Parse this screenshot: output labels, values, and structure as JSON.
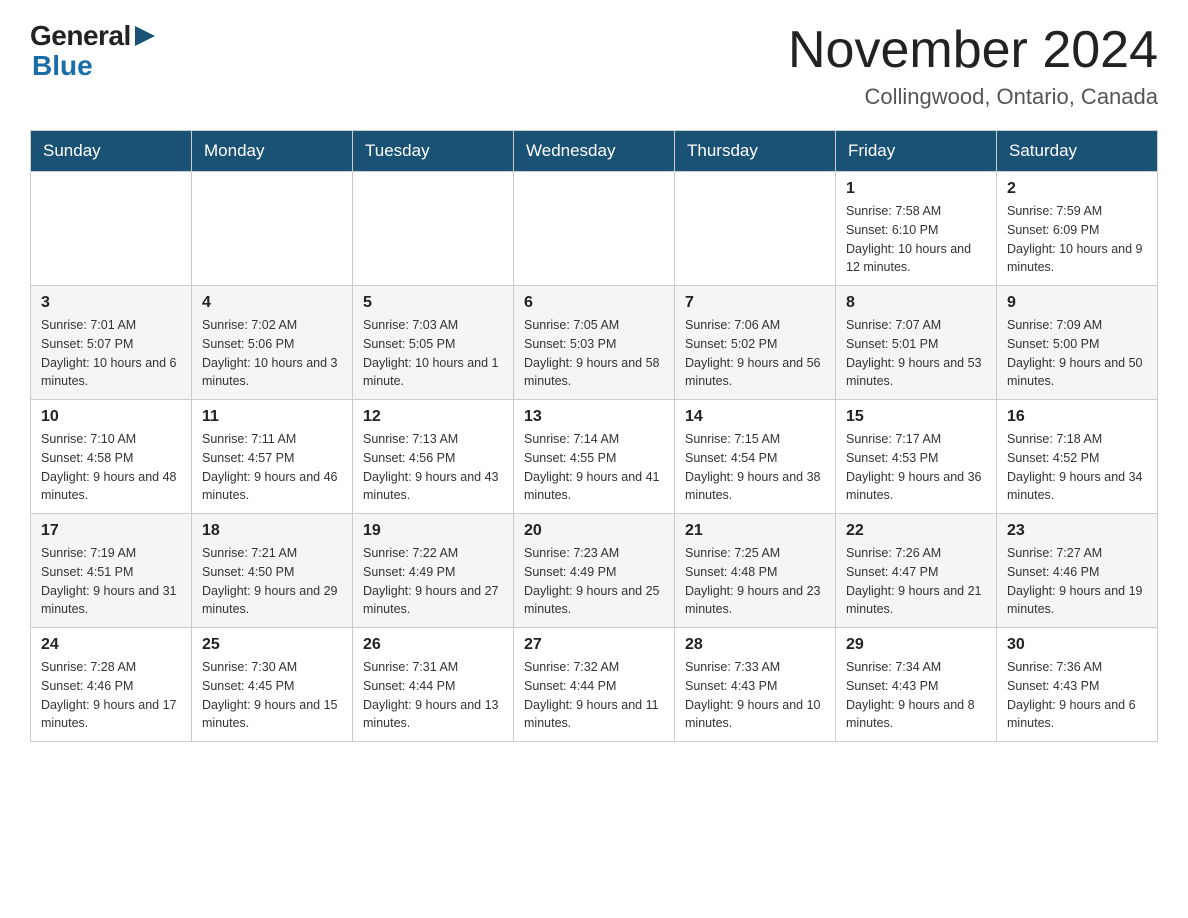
{
  "header": {
    "logo": {
      "general": "General",
      "blue": "Blue"
    },
    "title": "November 2024",
    "subtitle": "Collingwood, Ontario, Canada"
  },
  "weekdays": [
    "Sunday",
    "Monday",
    "Tuesday",
    "Wednesday",
    "Thursday",
    "Friday",
    "Saturday"
  ],
  "weeks": [
    [
      {
        "day": "",
        "sunrise": "",
        "sunset": "",
        "daylight": ""
      },
      {
        "day": "",
        "sunrise": "",
        "sunset": "",
        "daylight": ""
      },
      {
        "day": "",
        "sunrise": "",
        "sunset": "",
        "daylight": ""
      },
      {
        "day": "",
        "sunrise": "",
        "sunset": "",
        "daylight": ""
      },
      {
        "day": "",
        "sunrise": "",
        "sunset": "",
        "daylight": ""
      },
      {
        "day": "1",
        "sunrise": "Sunrise: 7:58 AM",
        "sunset": "Sunset: 6:10 PM",
        "daylight": "Daylight: 10 hours and 12 minutes."
      },
      {
        "day": "2",
        "sunrise": "Sunrise: 7:59 AM",
        "sunset": "Sunset: 6:09 PM",
        "daylight": "Daylight: 10 hours and 9 minutes."
      }
    ],
    [
      {
        "day": "3",
        "sunrise": "Sunrise: 7:01 AM",
        "sunset": "Sunset: 5:07 PM",
        "daylight": "Daylight: 10 hours and 6 minutes."
      },
      {
        "day": "4",
        "sunrise": "Sunrise: 7:02 AM",
        "sunset": "Sunset: 5:06 PM",
        "daylight": "Daylight: 10 hours and 3 minutes."
      },
      {
        "day": "5",
        "sunrise": "Sunrise: 7:03 AM",
        "sunset": "Sunset: 5:05 PM",
        "daylight": "Daylight: 10 hours and 1 minute."
      },
      {
        "day": "6",
        "sunrise": "Sunrise: 7:05 AM",
        "sunset": "Sunset: 5:03 PM",
        "daylight": "Daylight: 9 hours and 58 minutes."
      },
      {
        "day": "7",
        "sunrise": "Sunrise: 7:06 AM",
        "sunset": "Sunset: 5:02 PM",
        "daylight": "Daylight: 9 hours and 56 minutes."
      },
      {
        "day": "8",
        "sunrise": "Sunrise: 7:07 AM",
        "sunset": "Sunset: 5:01 PM",
        "daylight": "Daylight: 9 hours and 53 minutes."
      },
      {
        "day": "9",
        "sunrise": "Sunrise: 7:09 AM",
        "sunset": "Sunset: 5:00 PM",
        "daylight": "Daylight: 9 hours and 50 minutes."
      }
    ],
    [
      {
        "day": "10",
        "sunrise": "Sunrise: 7:10 AM",
        "sunset": "Sunset: 4:58 PM",
        "daylight": "Daylight: 9 hours and 48 minutes."
      },
      {
        "day": "11",
        "sunrise": "Sunrise: 7:11 AM",
        "sunset": "Sunset: 4:57 PM",
        "daylight": "Daylight: 9 hours and 46 minutes."
      },
      {
        "day": "12",
        "sunrise": "Sunrise: 7:13 AM",
        "sunset": "Sunset: 4:56 PM",
        "daylight": "Daylight: 9 hours and 43 minutes."
      },
      {
        "day": "13",
        "sunrise": "Sunrise: 7:14 AM",
        "sunset": "Sunset: 4:55 PM",
        "daylight": "Daylight: 9 hours and 41 minutes."
      },
      {
        "day": "14",
        "sunrise": "Sunrise: 7:15 AM",
        "sunset": "Sunset: 4:54 PM",
        "daylight": "Daylight: 9 hours and 38 minutes."
      },
      {
        "day": "15",
        "sunrise": "Sunrise: 7:17 AM",
        "sunset": "Sunset: 4:53 PM",
        "daylight": "Daylight: 9 hours and 36 minutes."
      },
      {
        "day": "16",
        "sunrise": "Sunrise: 7:18 AM",
        "sunset": "Sunset: 4:52 PM",
        "daylight": "Daylight: 9 hours and 34 minutes."
      }
    ],
    [
      {
        "day": "17",
        "sunrise": "Sunrise: 7:19 AM",
        "sunset": "Sunset: 4:51 PM",
        "daylight": "Daylight: 9 hours and 31 minutes."
      },
      {
        "day": "18",
        "sunrise": "Sunrise: 7:21 AM",
        "sunset": "Sunset: 4:50 PM",
        "daylight": "Daylight: 9 hours and 29 minutes."
      },
      {
        "day": "19",
        "sunrise": "Sunrise: 7:22 AM",
        "sunset": "Sunset: 4:49 PM",
        "daylight": "Daylight: 9 hours and 27 minutes."
      },
      {
        "day": "20",
        "sunrise": "Sunrise: 7:23 AM",
        "sunset": "Sunset: 4:49 PM",
        "daylight": "Daylight: 9 hours and 25 minutes."
      },
      {
        "day": "21",
        "sunrise": "Sunrise: 7:25 AM",
        "sunset": "Sunset: 4:48 PM",
        "daylight": "Daylight: 9 hours and 23 minutes."
      },
      {
        "day": "22",
        "sunrise": "Sunrise: 7:26 AM",
        "sunset": "Sunset: 4:47 PM",
        "daylight": "Daylight: 9 hours and 21 minutes."
      },
      {
        "day": "23",
        "sunrise": "Sunrise: 7:27 AM",
        "sunset": "Sunset: 4:46 PM",
        "daylight": "Daylight: 9 hours and 19 minutes."
      }
    ],
    [
      {
        "day": "24",
        "sunrise": "Sunrise: 7:28 AM",
        "sunset": "Sunset: 4:46 PM",
        "daylight": "Daylight: 9 hours and 17 minutes."
      },
      {
        "day": "25",
        "sunrise": "Sunrise: 7:30 AM",
        "sunset": "Sunset: 4:45 PM",
        "daylight": "Daylight: 9 hours and 15 minutes."
      },
      {
        "day": "26",
        "sunrise": "Sunrise: 7:31 AM",
        "sunset": "Sunset: 4:44 PM",
        "daylight": "Daylight: 9 hours and 13 minutes."
      },
      {
        "day": "27",
        "sunrise": "Sunrise: 7:32 AM",
        "sunset": "Sunset: 4:44 PM",
        "daylight": "Daylight: 9 hours and 11 minutes."
      },
      {
        "day": "28",
        "sunrise": "Sunrise: 7:33 AM",
        "sunset": "Sunset: 4:43 PM",
        "daylight": "Daylight: 9 hours and 10 minutes."
      },
      {
        "day": "29",
        "sunrise": "Sunrise: 7:34 AM",
        "sunset": "Sunset: 4:43 PM",
        "daylight": "Daylight: 9 hours and 8 minutes."
      },
      {
        "day": "30",
        "sunrise": "Sunrise: 7:36 AM",
        "sunset": "Sunset: 4:43 PM",
        "daylight": "Daylight: 9 hours and 6 minutes."
      }
    ]
  ]
}
